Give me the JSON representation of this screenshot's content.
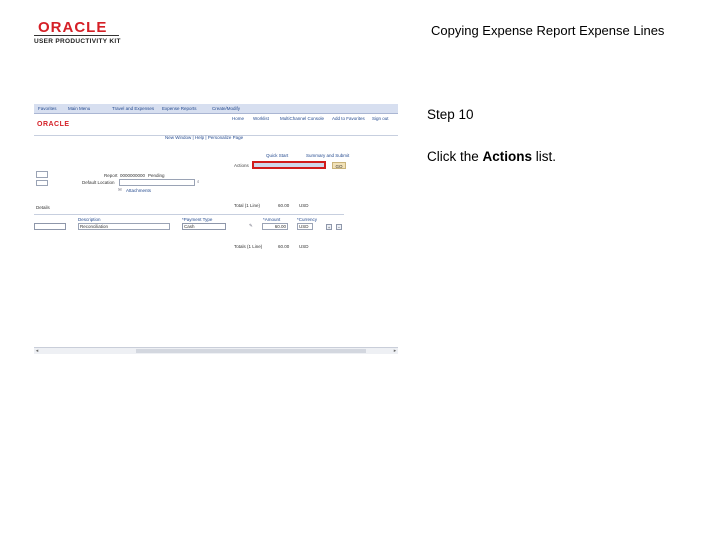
{
  "logo": {
    "brand": "ORACLE",
    "product": "USER PRODUCTIVITY KIT"
  },
  "document_title": "Copying Expense Report Expense Lines",
  "step": "Step 10",
  "instruction": {
    "prefix": "Click the ",
    "emphasis": "Actions",
    "suffix": " list."
  },
  "screenshot": {
    "nav": [
      "Favorites",
      "Main Menu",
      "Travel and Expenses",
      "Expense Reports",
      "Create/Modify"
    ],
    "brand": "ORACLE",
    "menu": [
      "Home",
      "Worklist",
      "MultiChannel Console",
      "Add to Favorites",
      "Sign out"
    ],
    "page_links": "New Window | Help | Personalize Page",
    "top_links": {
      "quick_start": "Quick Start",
      "summary": "Summary and Submit"
    },
    "actions_label": "Actions",
    "go_label": "GO",
    "report_label": "Report",
    "report_id": "0000000000",
    "report_status": "Pending",
    "default_location_label": "Default Location",
    "attachments": "Attachments",
    "section_title": "Details",
    "totals": {
      "total_label": "Total (1 Line)",
      "total_amount": "60.00",
      "currency": "USD"
    },
    "columns": {
      "description": "Description",
      "payment_type": "*Payment Type",
      "amount": "*Amount",
      "currency": "*Currency"
    },
    "row": {
      "description": "Reconciliation",
      "payment_type": "Cash",
      "amount": "60.00",
      "currency": "USD"
    },
    "footer_totals": {
      "label": "Totals (1 Line)",
      "amount": "60.00",
      "currency": "USD"
    }
  }
}
